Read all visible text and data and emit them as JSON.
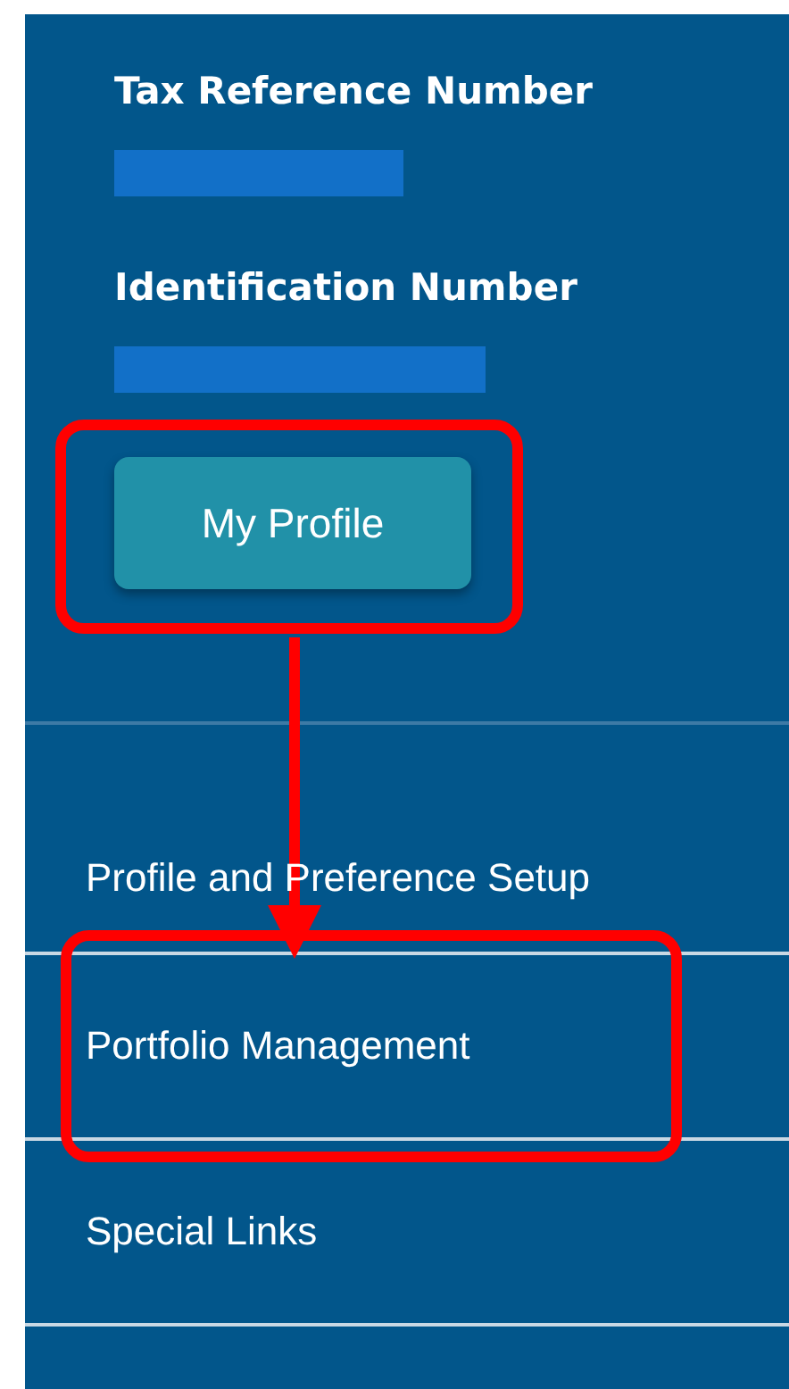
{
  "account": [
    {
      "label": "Tax Reference Number",
      "redacted": true
    },
    {
      "label": "Identification Number",
      "redacted": true
    }
  ],
  "profile_button": {
    "label": "My Profile"
  },
  "menu": [
    {
      "label": "Profile and Preference Setup",
      "highlighted": false
    },
    {
      "label": "Portfolio Management",
      "highlighted": true
    },
    {
      "label": "Special Links",
      "highlighted": false
    }
  ]
}
